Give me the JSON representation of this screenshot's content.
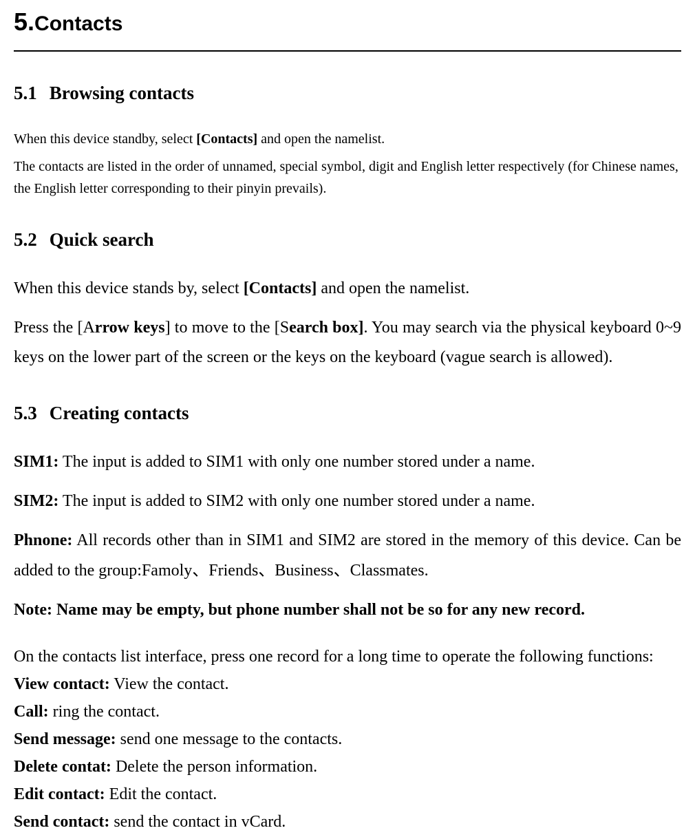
{
  "chapter": {
    "number": "5.",
    "title": "Contacts"
  },
  "sections": {
    "s51": {
      "number": "5.1",
      "title": "Browsing contacts",
      "p1_a": "When this device standby, select ",
      "p1_b": "[Contacts]",
      "p1_c": " and open the namelist.",
      "p2": "The contacts are listed in the order of unnamed, special symbol, digit and English letter respectively (for Chinese names, the English letter corresponding to their pinyin prevails)."
    },
    "s52": {
      "number": "5.2",
      "title": "Quick search",
      "p1_a": "When this device stands by, select ",
      "p1_b": "[Contacts]",
      "p1_c": " and open the namelist.",
      "p2_a": "Press the [A",
      "p2_b": "rrow keys",
      "p2_c": "] to move to the [S",
      "p2_d": "earch box]",
      "p2_e": ". You may search via the physical keyboard 0~9 keys on the lower part of the screen or the keys on the keyboard (vague search is allowed)."
    },
    "s53": {
      "number": "5.3",
      "title": "Creating contacts",
      "sim1_label": "SIM1:",
      "sim1_text": " The input is added to SIM1 with only one number stored under a name.",
      "sim2_label": "SIM2:",
      "sim2_text": " The input is added to SIM2 with only one number stored under a name.",
      "phone_label": "Phnone:",
      "phone_text": " All records other than in SIM1 and SIM2 are stored in the memory of this device. Can be added to the group:Famoly、Friends、Business、Classmates.",
      "note": "Note: Name may be empty, but phone number shall not be so for any new record.",
      "intro": "On the contacts list interface, press one record for a long time to operate the following functions:",
      "functions": {
        "view_label": "View contact:",
        "view_text": " View the contact.",
        "call_label": "Call:",
        "call_text": " ring the contact.",
        "send_msg_label": "Send message:",
        "send_msg_text": " send one message to the contacts.",
        "delete_label": "Delete contat:",
        "delete_text": " Delete the person information.",
        "edit_label": "Edit contact:",
        "edit_text": " Edit the contact.",
        "send_contact_label": "Send contact:",
        "send_contact_text": " send the contact in vCard."
      }
    }
  }
}
